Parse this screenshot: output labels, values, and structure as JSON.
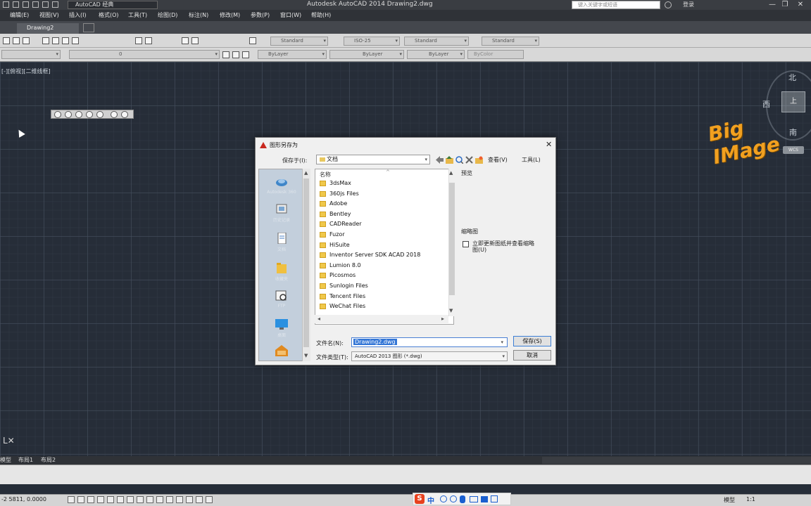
{
  "window": {
    "title": "Autodesk AutoCAD 2014    Drawing2.dwg",
    "workspace": "AutoCAD 经典",
    "search_placeholder": "键入关键字或短语",
    "user": "登录",
    "min": "—",
    "restore": "❐",
    "close": "✕"
  },
  "menu": [
    "编辑(E)",
    "视图(V)",
    "插入(I)",
    "格式(O)",
    "工具(T)",
    "绘图(D)",
    "标注(N)",
    "修改(M)",
    "参数(P)",
    "窗口(W)",
    "帮助(H)"
  ],
  "tabs": {
    "active": "Drawing2"
  },
  "toolbar": {
    "text_style": "Standard",
    "dim_style": "ISO-25",
    "table_style": "Standard",
    "mleader_style": "Standard",
    "layer": "0",
    "color": "ByLayer",
    "linetype": "ByLayer",
    "lineweight": "ByLayer",
    "plotstyle": "ByColor"
  },
  "canvas": {
    "viewport_label": "[-][俯视][二维线框]",
    "compass": {
      "north": "北",
      "west": "西",
      "south": "南",
      "top": "上"
    },
    "wcs": "WCS",
    "watermark": "Big IMage"
  },
  "layout_tabs": [
    "模型",
    "布局1",
    "布局2"
  ],
  "status": {
    "coords": "-2 5811, 0.0000",
    "model": "模型",
    "scale": "1:1"
  },
  "ime": {
    "s": "S",
    "zh": "中"
  },
  "dialog": {
    "title": "图形另存为",
    "save_in_label": "保存于(I):",
    "save_in_value": "文档",
    "views_label": "查看(V)",
    "tools_label": "工具(L)",
    "places": [
      "Autodesk 360",
      "历史记录",
      "文档",
      "收藏夹",
      "FTP",
      "桌面",
      ""
    ],
    "column_name": "名称",
    "files": [
      "3dsMax",
      "360js Files",
      "Adobe",
      "Bentley",
      "CADReader",
      "Fuzor",
      "HiSuite",
      "Inventor Server SDK ACAD 2018",
      "Lumion 8.0",
      "Picosmos",
      "Sunlogin Files",
      "Tencent Files",
      "WeChat Files"
    ],
    "preview_label": "预览",
    "thumbnail_label": "缩略图",
    "update_thumb_label": "立即更新图纸并查看缩略图(U)",
    "filename_label": "文件名(N):",
    "filename_value": "Drawing2.dwg",
    "filetype_label": "文件类型(T):",
    "filetype_value": "AutoCAD 2013 图形 (*.dwg)",
    "save_button": "保存(S)",
    "cancel_button": "取消"
  }
}
